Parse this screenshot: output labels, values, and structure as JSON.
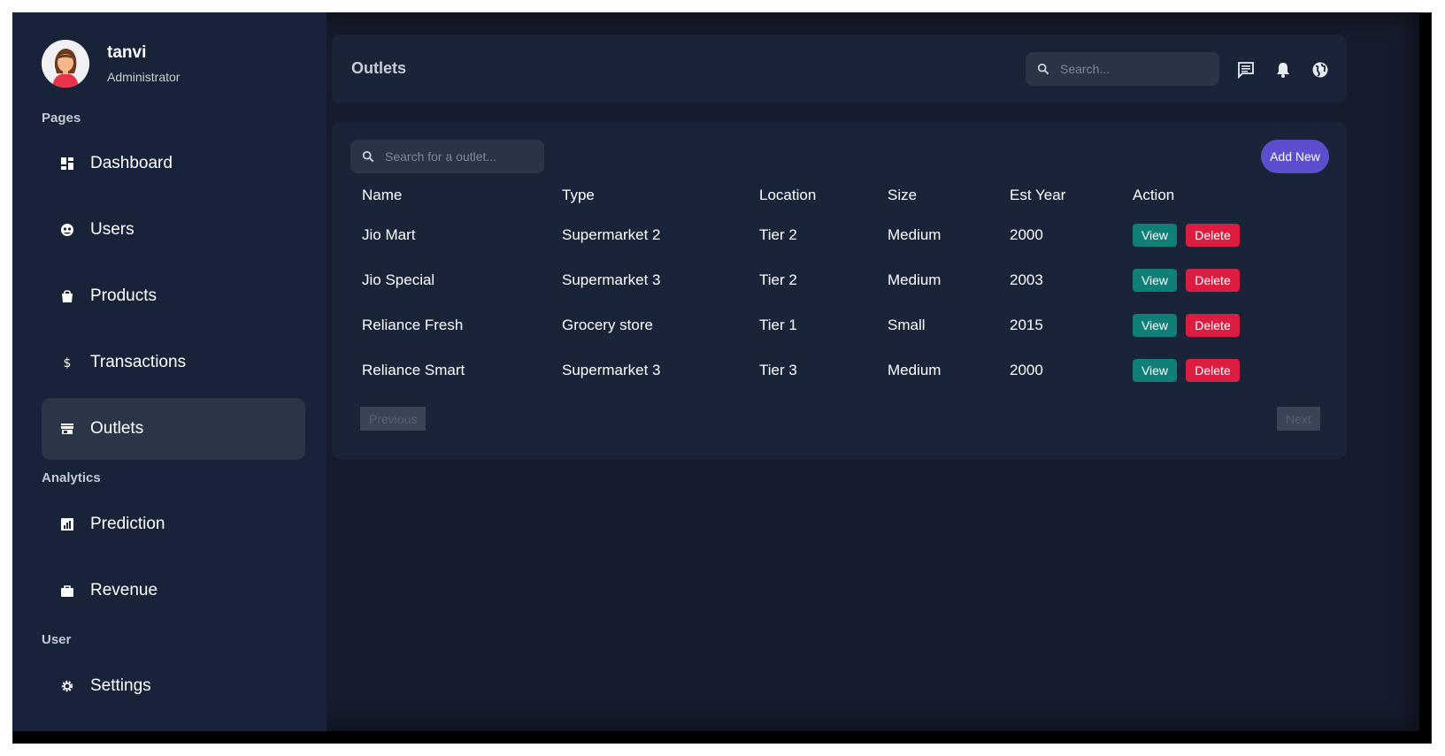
{
  "profile": {
    "name": "tanvi",
    "role": "Administrator"
  },
  "sidebar": {
    "sections": [
      "Pages",
      "Analytics",
      "User"
    ],
    "items": [
      {
        "label": "Dashboard",
        "icon": "dashboard-icon"
      },
      {
        "label": "Users",
        "icon": "users-icon"
      },
      {
        "label": "Products",
        "icon": "bag-icon"
      },
      {
        "label": "Transactions",
        "icon": "dollar-icon"
      },
      {
        "label": "Outlets",
        "icon": "store-icon",
        "active": true
      },
      {
        "label": "Prediction",
        "icon": "chart-icon"
      },
      {
        "label": "Revenue",
        "icon": "briefcase-icon"
      },
      {
        "label": "Settings",
        "icon": "gear-icon"
      }
    ]
  },
  "header": {
    "title": "Outlets",
    "search_placeholder": "Search...",
    "icons": [
      "chat-icon",
      "bell-icon",
      "globe-icon"
    ]
  },
  "main": {
    "search_placeholder": "Search for a outlet...",
    "add_label": "Add New",
    "columns": [
      "Name",
      "Type",
      "Location",
      "Size",
      "Est Year",
      "Action"
    ],
    "rows": [
      {
        "name": "Jio Mart",
        "type": "Supermarket 2",
        "location": "Tier 2",
        "size": "Medium",
        "year": "2000"
      },
      {
        "name": "Jio Special",
        "type": "Supermarket 3",
        "location": "Tier 2",
        "size": "Medium",
        "year": "2003"
      },
      {
        "name": "Reliance Fresh",
        "type": "Grocery store",
        "location": "Tier 1",
        "size": "Small",
        "year": "2015"
      },
      {
        "name": "Reliance Smart",
        "type": "Supermarket 3",
        "location": "Tier 3",
        "size": "Medium",
        "year": "2000"
      }
    ],
    "view_label": "View",
    "delete_label": "Delete",
    "prev_label": "Previous",
    "next_label": "Next"
  },
  "colors": {
    "accent": "#5b4fcf",
    "view": "#0f7f78",
    "delete": "#dc1d42",
    "bg": "#161c2d",
    "sidebar": "#182339"
  }
}
